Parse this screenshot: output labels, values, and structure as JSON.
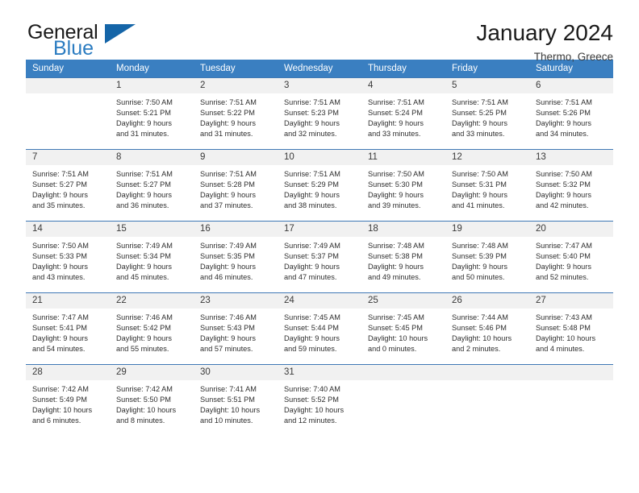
{
  "brand": {
    "name_part1": "General",
    "name_part2": "Blue",
    "triangle_color": "#1565a8",
    "accent_color": "#2b7cc1"
  },
  "header": {
    "title": "January 2024",
    "subtitle": "Thermo, Greece"
  },
  "theme": {
    "header_row_bg": "#3a7fc1",
    "day_number_bg": "#f1f1f1",
    "row_border": "#3f78b5",
    "text": "#2e2e2e"
  },
  "calendar": {
    "weekday_headers": [
      "Sunday",
      "Monday",
      "Tuesday",
      "Wednesday",
      "Thursday",
      "Friday",
      "Saturday"
    ],
    "labels": {
      "sunrise": "Sunrise:",
      "sunset": "Sunset:",
      "daylight": "Daylight:"
    },
    "weeks": [
      [
        {
          "day": "",
          "empty": true,
          "sunrise": "",
          "sunset": "",
          "daylight_line1": "",
          "daylight_line2": ""
        },
        {
          "day": "1",
          "sunrise": "Sunrise: 7:50 AM",
          "sunset": "Sunset: 5:21 PM",
          "daylight_line1": "Daylight: 9 hours",
          "daylight_line2": "and 31 minutes."
        },
        {
          "day": "2",
          "sunrise": "Sunrise: 7:51 AM",
          "sunset": "Sunset: 5:22 PM",
          "daylight_line1": "Daylight: 9 hours",
          "daylight_line2": "and 31 minutes."
        },
        {
          "day": "3",
          "sunrise": "Sunrise: 7:51 AM",
          "sunset": "Sunset: 5:23 PM",
          "daylight_line1": "Daylight: 9 hours",
          "daylight_line2": "and 32 minutes."
        },
        {
          "day": "4",
          "sunrise": "Sunrise: 7:51 AM",
          "sunset": "Sunset: 5:24 PM",
          "daylight_line1": "Daylight: 9 hours",
          "daylight_line2": "and 33 minutes."
        },
        {
          "day": "5",
          "sunrise": "Sunrise: 7:51 AM",
          "sunset": "Sunset: 5:25 PM",
          "daylight_line1": "Daylight: 9 hours",
          "daylight_line2": "and 33 minutes."
        },
        {
          "day": "6",
          "sunrise": "Sunrise: 7:51 AM",
          "sunset": "Sunset: 5:26 PM",
          "daylight_line1": "Daylight: 9 hours",
          "daylight_line2": "and 34 minutes."
        }
      ],
      [
        {
          "day": "7",
          "sunrise": "Sunrise: 7:51 AM",
          "sunset": "Sunset: 5:27 PM",
          "daylight_line1": "Daylight: 9 hours",
          "daylight_line2": "and 35 minutes."
        },
        {
          "day": "8",
          "sunrise": "Sunrise: 7:51 AM",
          "sunset": "Sunset: 5:27 PM",
          "daylight_line1": "Daylight: 9 hours",
          "daylight_line2": "and 36 minutes."
        },
        {
          "day": "9",
          "sunrise": "Sunrise: 7:51 AM",
          "sunset": "Sunset: 5:28 PM",
          "daylight_line1": "Daylight: 9 hours",
          "daylight_line2": "and 37 minutes."
        },
        {
          "day": "10",
          "sunrise": "Sunrise: 7:51 AM",
          "sunset": "Sunset: 5:29 PM",
          "daylight_line1": "Daylight: 9 hours",
          "daylight_line2": "and 38 minutes."
        },
        {
          "day": "11",
          "sunrise": "Sunrise: 7:50 AM",
          "sunset": "Sunset: 5:30 PM",
          "daylight_line1": "Daylight: 9 hours",
          "daylight_line2": "and 39 minutes."
        },
        {
          "day": "12",
          "sunrise": "Sunrise: 7:50 AM",
          "sunset": "Sunset: 5:31 PM",
          "daylight_line1": "Daylight: 9 hours",
          "daylight_line2": "and 41 minutes."
        },
        {
          "day": "13",
          "sunrise": "Sunrise: 7:50 AM",
          "sunset": "Sunset: 5:32 PM",
          "daylight_line1": "Daylight: 9 hours",
          "daylight_line2": "and 42 minutes."
        }
      ],
      [
        {
          "day": "14",
          "sunrise": "Sunrise: 7:50 AM",
          "sunset": "Sunset: 5:33 PM",
          "daylight_line1": "Daylight: 9 hours",
          "daylight_line2": "and 43 minutes."
        },
        {
          "day": "15",
          "sunrise": "Sunrise: 7:49 AM",
          "sunset": "Sunset: 5:34 PM",
          "daylight_line1": "Daylight: 9 hours",
          "daylight_line2": "and 45 minutes."
        },
        {
          "day": "16",
          "sunrise": "Sunrise: 7:49 AM",
          "sunset": "Sunset: 5:35 PM",
          "daylight_line1": "Daylight: 9 hours",
          "daylight_line2": "and 46 minutes."
        },
        {
          "day": "17",
          "sunrise": "Sunrise: 7:49 AM",
          "sunset": "Sunset: 5:37 PM",
          "daylight_line1": "Daylight: 9 hours",
          "daylight_line2": "and 47 minutes."
        },
        {
          "day": "18",
          "sunrise": "Sunrise: 7:48 AM",
          "sunset": "Sunset: 5:38 PM",
          "daylight_line1": "Daylight: 9 hours",
          "daylight_line2": "and 49 minutes."
        },
        {
          "day": "19",
          "sunrise": "Sunrise: 7:48 AM",
          "sunset": "Sunset: 5:39 PM",
          "daylight_line1": "Daylight: 9 hours",
          "daylight_line2": "and 50 minutes."
        },
        {
          "day": "20",
          "sunrise": "Sunrise: 7:47 AM",
          "sunset": "Sunset: 5:40 PM",
          "daylight_line1": "Daylight: 9 hours",
          "daylight_line2": "and 52 minutes."
        }
      ],
      [
        {
          "day": "21",
          "sunrise": "Sunrise: 7:47 AM",
          "sunset": "Sunset: 5:41 PM",
          "daylight_line1": "Daylight: 9 hours",
          "daylight_line2": "and 54 minutes."
        },
        {
          "day": "22",
          "sunrise": "Sunrise: 7:46 AM",
          "sunset": "Sunset: 5:42 PM",
          "daylight_line1": "Daylight: 9 hours",
          "daylight_line2": "and 55 minutes."
        },
        {
          "day": "23",
          "sunrise": "Sunrise: 7:46 AM",
          "sunset": "Sunset: 5:43 PM",
          "daylight_line1": "Daylight: 9 hours",
          "daylight_line2": "and 57 minutes."
        },
        {
          "day": "24",
          "sunrise": "Sunrise: 7:45 AM",
          "sunset": "Sunset: 5:44 PM",
          "daylight_line1": "Daylight: 9 hours",
          "daylight_line2": "and 59 minutes."
        },
        {
          "day": "25",
          "sunrise": "Sunrise: 7:45 AM",
          "sunset": "Sunset: 5:45 PM",
          "daylight_line1": "Daylight: 10 hours",
          "daylight_line2": "and 0 minutes."
        },
        {
          "day": "26",
          "sunrise": "Sunrise: 7:44 AM",
          "sunset": "Sunset: 5:46 PM",
          "daylight_line1": "Daylight: 10 hours",
          "daylight_line2": "and 2 minutes."
        },
        {
          "day": "27",
          "sunrise": "Sunrise: 7:43 AM",
          "sunset": "Sunset: 5:48 PM",
          "daylight_line1": "Daylight: 10 hours",
          "daylight_line2": "and 4 minutes."
        }
      ],
      [
        {
          "day": "28",
          "sunrise": "Sunrise: 7:42 AM",
          "sunset": "Sunset: 5:49 PM",
          "daylight_line1": "Daylight: 10 hours",
          "daylight_line2": "and 6 minutes."
        },
        {
          "day": "29",
          "sunrise": "Sunrise: 7:42 AM",
          "sunset": "Sunset: 5:50 PM",
          "daylight_line1": "Daylight: 10 hours",
          "daylight_line2": "and 8 minutes."
        },
        {
          "day": "30",
          "sunrise": "Sunrise: 7:41 AM",
          "sunset": "Sunset: 5:51 PM",
          "daylight_line1": "Daylight: 10 hours",
          "daylight_line2": "and 10 minutes."
        },
        {
          "day": "31",
          "sunrise": "Sunrise: 7:40 AM",
          "sunset": "Sunset: 5:52 PM",
          "daylight_line1": "Daylight: 10 hours",
          "daylight_line2": "and 12 minutes."
        },
        {
          "day": "",
          "empty": true,
          "sunrise": "",
          "sunset": "",
          "daylight_line1": "",
          "daylight_line2": ""
        },
        {
          "day": "",
          "empty": true,
          "sunrise": "",
          "sunset": "",
          "daylight_line1": "",
          "daylight_line2": ""
        },
        {
          "day": "",
          "empty": true,
          "sunrise": "",
          "sunset": "",
          "daylight_line1": "",
          "daylight_line2": ""
        }
      ]
    ]
  }
}
